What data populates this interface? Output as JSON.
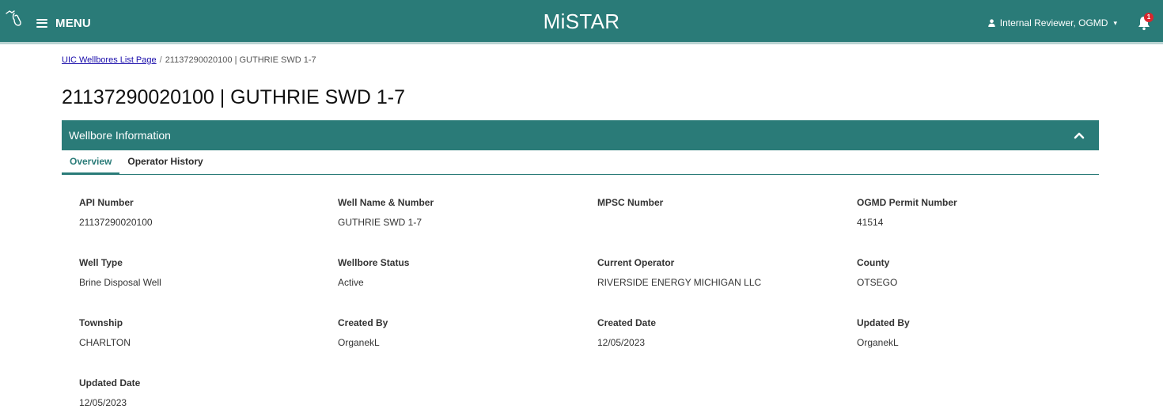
{
  "header": {
    "menu_label": "MENU",
    "app_title": "MiSTAR",
    "user_label": "Internal Reviewer, OGMD",
    "notification_count": "1",
    "brand_color": "#2a7b78"
  },
  "breadcrumb": {
    "link_label": "UIC Wellbores List Page",
    "separator": "/",
    "current": "21137290020100 | GUTHRIE SWD 1-7"
  },
  "page_title": "21137290020100 | GUTHRIE SWD 1-7",
  "panel": {
    "title": "Wellbore Information",
    "tabs": [
      {
        "label": "Overview"
      },
      {
        "label": "Operator History"
      }
    ]
  },
  "fields": [
    {
      "label": "API Number",
      "value": "21137290020100"
    },
    {
      "label": "Well Name & Number",
      "value": "GUTHRIE SWD 1-7"
    },
    {
      "label": "MPSC Number",
      "value": ""
    },
    {
      "label": "OGMD Permit Number",
      "value": "41514"
    },
    {
      "label": "Well Type",
      "value": "Brine Disposal Well"
    },
    {
      "label": "Wellbore Status",
      "value": "Active"
    },
    {
      "label": "Current Operator",
      "value": "RIVERSIDE ENERGY MICHIGAN LLC"
    },
    {
      "label": "County",
      "value": "OTSEGO"
    },
    {
      "label": "Township",
      "value": "CHARLTON"
    },
    {
      "label": "Created By",
      "value": "OrganekL"
    },
    {
      "label": "Created Date",
      "value": "12/05/2023"
    },
    {
      "label": "Updated By",
      "value": "OrganekL"
    },
    {
      "label": "Updated Date",
      "value": "12/05/2023"
    }
  ]
}
